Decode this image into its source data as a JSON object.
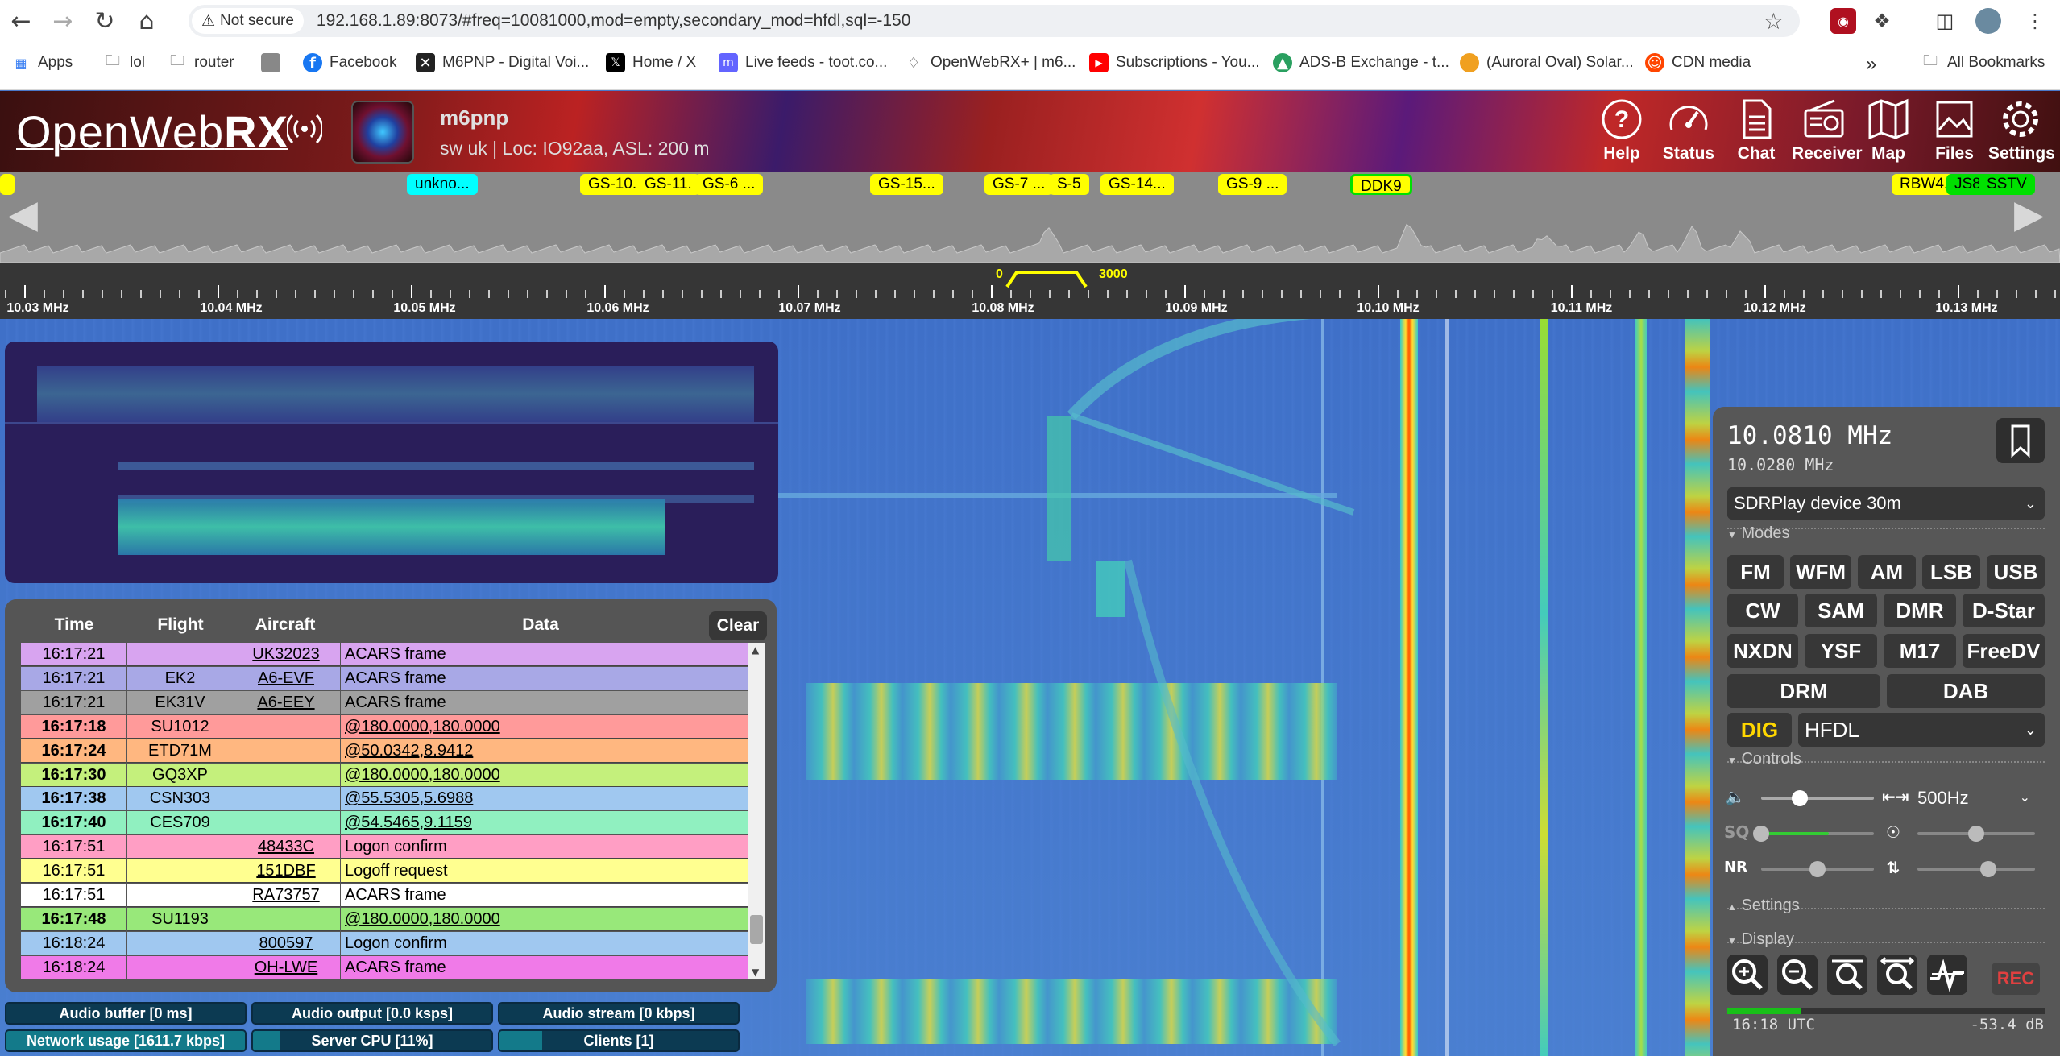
{
  "browser": {
    "security_label": "Not secure",
    "url": "192.168.1.89:8073/#freq=10081000,mod=empty,secondary_mod=hfdl,sql=-150"
  },
  "bookmarks_bar": {
    "items": [
      {
        "label": "Apps",
        "icon": "apps-grid-icon"
      },
      {
        "label": "lol",
        "icon": "folder-icon"
      },
      {
        "label": "router",
        "icon": "folder-icon"
      },
      {
        "label": "",
        "icon": "site-favicon-icon"
      },
      {
        "label": "Facebook",
        "icon": "facebook-icon"
      },
      {
        "label": "M6PNP - Digital Voi...",
        "icon": "site-favicon-icon"
      },
      {
        "label": "Home / X",
        "icon": "x-icon"
      },
      {
        "label": "Live feeds - toot.co...",
        "icon": "mastodon-icon"
      },
      {
        "label": "OpenWebRX+ | m6...",
        "icon": "site-favicon-icon"
      },
      {
        "label": "Subscriptions - You...",
        "icon": "youtube-icon"
      },
      {
        "label": "ADS-B Exchange - t...",
        "icon": "site-favicon-icon"
      },
      {
        "label": "(Auroral Oval) Solar...",
        "icon": "site-favicon-icon"
      },
      {
        "label": "CDN media",
        "icon": "reddit-icon"
      }
    ],
    "all_bookmarks": "All Bookmarks"
  },
  "header": {
    "logo_light": "OpenWeb",
    "logo_bold": "RX",
    "receiver_name": "m6pnp",
    "receiver_desc": "sw uk | Loc: IO92aa, ASL: 200 m",
    "buttons": [
      "Help",
      "Status",
      "Chat",
      "Receiver",
      "Map",
      "Files",
      "Settings"
    ]
  },
  "band": {
    "tags": [
      {
        "label": "unkno...",
        "color": "#00ffff"
      },
      {
        "label": "GS-10.",
        "color": "#ffff00"
      },
      {
        "label": "GS-11.",
        "color": "#ffff00"
      },
      {
        "label": "GS-6 ...",
        "color": "#ffff00"
      },
      {
        "label": "GS-15...",
        "color": "#ffff00"
      },
      {
        "label": "GS-7 ...",
        "color": "#ffff00"
      },
      {
        "label": "S-5",
        "color": "#ffff00"
      },
      {
        "label": "GS-14...",
        "color": "#ffff00"
      },
      {
        "label": "GS-9 ...",
        "color": "#ffff00"
      },
      {
        "label": "DDK9",
        "color": "#ffff00"
      },
      {
        "label": "RBW4...",
        "color": "#ffff00"
      },
      {
        "label": "JS8",
        "color": "#00e000"
      },
      {
        "label": "SSTV",
        "color": "#00e000"
      }
    ]
  },
  "scale": {
    "labels": [
      "10.03 MHz",
      "10.04 MHz",
      "10.05 MHz",
      "10.06 MHz",
      "10.07 MHz",
      "10.08 MHz",
      "10.09 MHz",
      "10.10 MHz",
      "10.11 MHz",
      "10.12 MHz",
      "10.13 MHz"
    ],
    "passband_low": "0",
    "passband_high": "3000"
  },
  "messages": {
    "columns": [
      "Time",
      "Flight",
      "Aircraft",
      "Data"
    ],
    "clear_label": "Clear",
    "rows": [
      {
        "time": "16:17:21",
        "flight": "",
        "aircraft": "UK32023",
        "data": "ACARS frame",
        "bg": "#d8a4f0",
        "bold": false,
        "link": false
      },
      {
        "time": "16:17:21",
        "flight": "EK2",
        "aircraft": "A6-EVF",
        "data": "ACARS frame",
        "bg": "#a8a8e6",
        "bold": false,
        "link": false
      },
      {
        "time": "16:17:21",
        "flight": "EK31V",
        "aircraft": "A6-EEY",
        "data": "ACARS frame",
        "bg": "#a0a0a0",
        "bold": false,
        "link": false
      },
      {
        "time": "16:17:18",
        "flight": "SU1012",
        "aircraft": "",
        "data": "@180.0000,180.0000",
        "bg": "#ff9a9a",
        "bold": true,
        "link": true
      },
      {
        "time": "16:17:24",
        "flight": "ETD71M",
        "aircraft": "",
        "data": "@50.0342,8.9412",
        "bg": "#ffb780",
        "bold": true,
        "link": true
      },
      {
        "time": "16:17:30",
        "flight": "GQ3XP",
        "aircraft": "",
        "data": "@180.0000,180.0000",
        "bg": "#c4f07c",
        "bold": true,
        "link": true
      },
      {
        "time": "16:17:38",
        "flight": "CSN303",
        "aircraft": "",
        "data": "@55.5305,5.6988",
        "bg": "#a0c8f0",
        "bold": true,
        "link": true
      },
      {
        "time": "16:17:40",
        "flight": "CES709",
        "aircraft": "",
        "data": "@54.5465,9.1159",
        "bg": "#90f0c0",
        "bold": true,
        "link": true
      },
      {
        "time": "16:17:51",
        "flight": "",
        "aircraft": "48433C",
        "data": "Logon confirm",
        "bg": "#ff9ec4",
        "bold": false,
        "link": false
      },
      {
        "time": "16:17:51",
        "flight": "",
        "aircraft": "151DBF",
        "data": "Logoff request",
        "bg": "#ffff90",
        "bold": false,
        "link": false
      },
      {
        "time": "16:17:51",
        "flight": "",
        "aircraft": "RA73757",
        "data": "ACARS frame",
        "bg": "#ffffff",
        "bold": false,
        "link": false
      },
      {
        "time": "16:17:48",
        "flight": "SU1193",
        "aircraft": "",
        "data": "@180.0000,180.0000",
        "bg": "#98e87a",
        "bold": true,
        "link": true
      },
      {
        "time": "16:18:24",
        "flight": "",
        "aircraft": "800597",
        "data": "Logon confirm",
        "bg": "#a0c8f0",
        "bold": false,
        "link": false
      },
      {
        "time": "16:18:24",
        "flight": "",
        "aircraft": "OH-LWE",
        "data": "ACARS frame",
        "bg": "#f07ae8",
        "bold": false,
        "link": false
      }
    ]
  },
  "status": {
    "audio_buffer": "Audio buffer [0 ms]",
    "audio_output": "Audio output [0.0 ksps]",
    "audio_stream": "Audio stream [0 kbps]",
    "network_usage": "Network usage [1611.7 kbps]",
    "server_cpu": "Server CPU [11%]",
    "server_cpu_level": 0.11,
    "clients": "Clients [1]"
  },
  "receiver": {
    "frequency": "10.0810 MHz",
    "center_frequency": "10.0280 MHz",
    "profile": "SDRPlay device 30m",
    "sections": {
      "modes": "Modes",
      "controls": "Controls",
      "settings": "Settings",
      "display": "Display"
    },
    "modes_row1": [
      "FM",
      "WFM",
      "AM",
      "LSB",
      "USB"
    ],
    "modes_row2": [
      "CW",
      "SAM",
      "DMR",
      "D-Star"
    ],
    "modes_row3": [
      "NXDN",
      "YSF",
      "M17",
      "FreeDV"
    ],
    "modes_row4": [
      "DRM",
      "DAB"
    ],
    "dig_label": "DIG",
    "dig_mode": "HFDL",
    "bandwidth": "500Hz",
    "sq_label": "SQ",
    "nr_label": "NR",
    "rec_label": "REC",
    "utc": "16:18 UTC",
    "db": "-53.4 dB",
    "volume_level": 0.34,
    "squelch_level": 0.0,
    "nr_level": 0.5,
    "agc_level": 0.5,
    "nr2_level": 0.6,
    "smeter_level": 0.23
  }
}
